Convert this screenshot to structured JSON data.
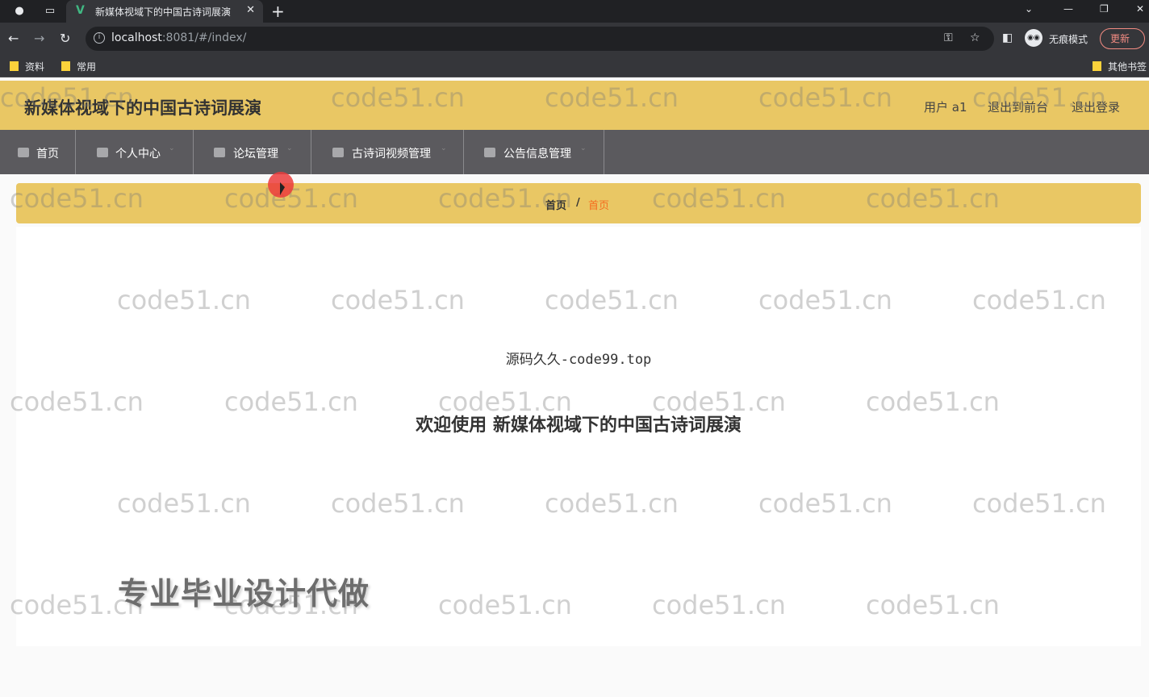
{
  "browser": {
    "tab_title": "新媒体视域下的中国古诗词展演",
    "url_host": "localhost",
    "url_rest": ":8081/#/index/",
    "profile_label": "无痕模式",
    "update_label": "更新",
    "bookmarks": [
      "资料",
      "常用"
    ],
    "other_bookmarks": "其他书签"
  },
  "header": {
    "title": "新媒体视域下的中国古诗词展演",
    "user": "用户 a1",
    "to_front": "退出到前台",
    "logout": "退出登录"
  },
  "menu": [
    {
      "label": "首页",
      "icon": "home-icon"
    },
    {
      "label": "个人中心",
      "icon": "user-icon"
    },
    {
      "label": "论坛管理",
      "icon": "user-icon"
    },
    {
      "label": "古诗词视频管理",
      "icon": "bell-icon"
    },
    {
      "label": "公告信息管理",
      "icon": "trophy-icon"
    }
  ],
  "breadcrumb": {
    "home": "首页",
    "separator": "/",
    "current": "首页"
  },
  "content": {
    "subtitle": "源码久久-code99.top",
    "welcome": "欢迎使用 新媒体视域下的中国古诗词展演",
    "promo": "专业毕业设计代做"
  },
  "watermark": "code51.cn",
  "colors": {
    "header": "#e9c764",
    "menubar": "#5b5a5e",
    "accent": "#f56c1f"
  }
}
